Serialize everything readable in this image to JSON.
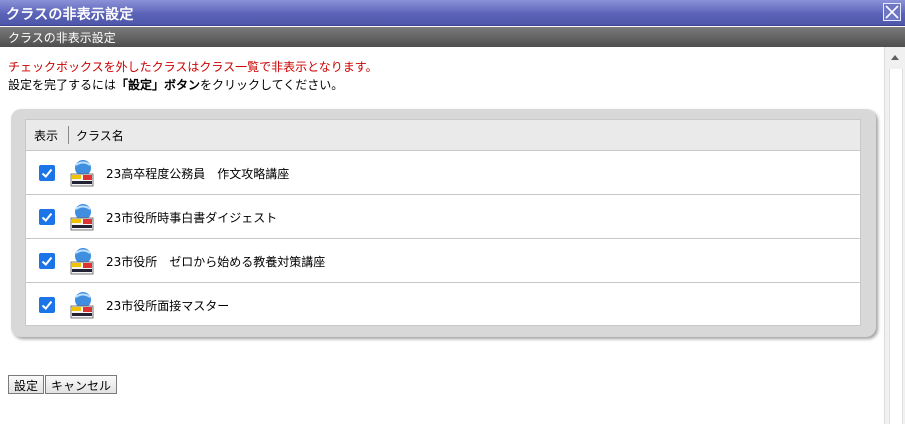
{
  "dialog": {
    "title": "クラスの非表示設定",
    "subtitle": "クラスの非表示設定"
  },
  "instructions": {
    "warning": "チェックボックスを外したクラスはクラス一覧で非表示となります。",
    "prefix": "設定を完了するには",
    "button_ref": "「設定」ボタン",
    "suffix": "をクリックしてください。"
  },
  "table": {
    "columns": {
      "show": "表示",
      "name": "クラス名"
    },
    "rows": [
      {
        "checked": true,
        "name": "23高卒程度公務員　作文攻略講座"
      },
      {
        "checked": true,
        "name": "23市役所時事白書ダイジェスト"
      },
      {
        "checked": true,
        "name": "23市役所　ゼロから始める教養対策講座"
      },
      {
        "checked": true,
        "name": "23市役所面接マスター"
      }
    ]
  },
  "buttons": {
    "ok": "設定",
    "cancel": "キャンセル"
  },
  "icons": {
    "close": "close-icon",
    "checkbox": "checkmark-icon",
    "class": "class-globe-icon"
  },
  "colors": {
    "title_bar": "#5b63b8",
    "warning_text": "#cc0000",
    "checkbox": "#1b74e8"
  }
}
